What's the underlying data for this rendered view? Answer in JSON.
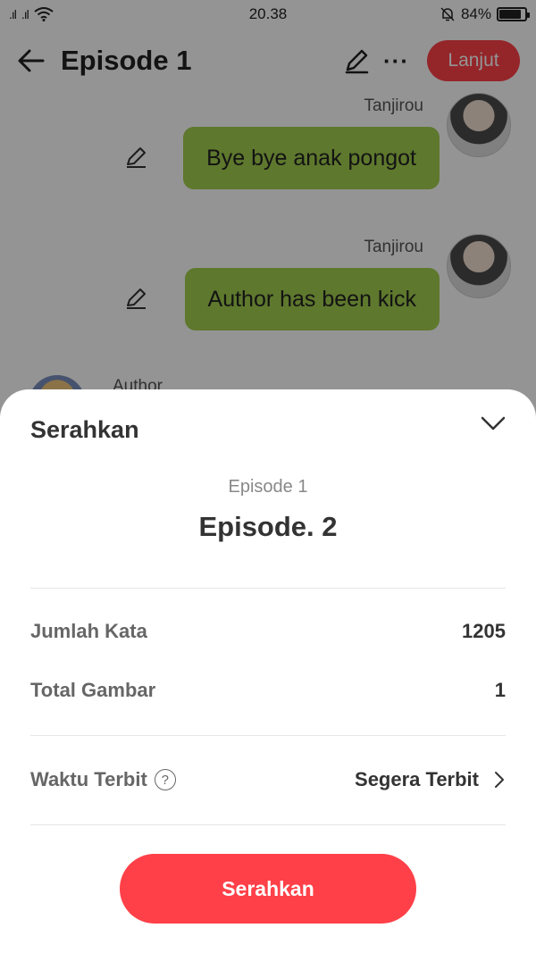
{
  "status_bar": {
    "time": "20.38",
    "battery_text": "84%",
    "battery_level": 0.84
  },
  "header": {
    "title": "Episode 1",
    "next_label": "Lanjut"
  },
  "chat": {
    "messages": [
      {
        "sender": "Tanjirou",
        "text": "Bye bye anak pongot"
      },
      {
        "sender": "Tanjirou",
        "text": "Author has been kick"
      }
    ],
    "partial_sender": "Author"
  },
  "sheet": {
    "title": "Serahkan",
    "episode_label": "Episode 1",
    "episode_title": "Episode. 2",
    "rows": [
      {
        "label": "Jumlah Kata",
        "value": "1205"
      },
      {
        "label": "Total Gambar",
        "value": "1"
      }
    ],
    "publish_time": {
      "label": "Waktu Terbit",
      "value": "Segera Terbit"
    },
    "submit_label": "Serahkan"
  },
  "colors": {
    "accent": "#ff4048",
    "bubble": "#a3cf4e"
  }
}
